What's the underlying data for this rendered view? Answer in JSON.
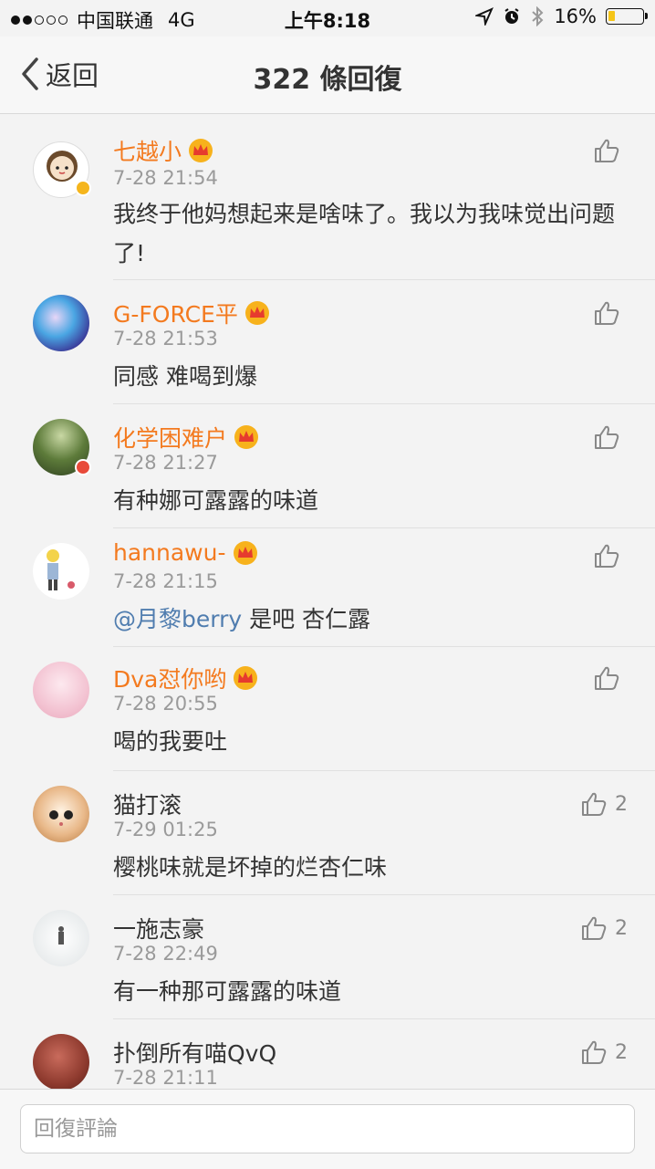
{
  "status": {
    "carrier": "中国联通",
    "network": "4G",
    "time": "上午8:18",
    "battery": "16%"
  },
  "nav": {
    "back_label": "返回",
    "title": "322 條回復"
  },
  "comments": [
    {
      "name": "七越小",
      "time": "7-28 21:54",
      "text": "我终于他妈想起来是啥味了。我以为我味觉出问题了!",
      "likes": "",
      "vip": true
    },
    {
      "name": "G-FORCE平",
      "time": "7-28 21:53",
      "text": "同感 难喝到爆",
      "likes": "",
      "vip": true
    },
    {
      "name": "化学困难户",
      "time": "7-28 21:27",
      "text": "有种娜可露露的味道",
      "likes": "",
      "vip": true
    },
    {
      "name": "hannawu-",
      "time": "7-28 21:15",
      "mention": "@月黎berry",
      "text": " 是吧 杏仁露",
      "likes": "",
      "vip": true
    },
    {
      "name": "Dva怼你哟",
      "time": "7-28 20:55",
      "text": "喝的我要吐",
      "likes": "",
      "vip": true
    },
    {
      "name": "猫打滚",
      "time": "7-29 01:25",
      "text": "樱桃味就是坏掉的烂杏仁味",
      "likes": "2",
      "vip": false
    },
    {
      "name": "一施志豪",
      "time": "7-28 22:49",
      "text": "有一种那可露露的味道",
      "likes": "2",
      "vip": false
    },
    {
      "name": "扑倒所有喵QvQ",
      "time": "7-28 21:11",
      "text": "",
      "likes": "2",
      "vip": false
    }
  ],
  "input": {
    "placeholder": "回復評論"
  },
  "colors": {
    "vip_name": "#f37a1f",
    "mention": "#507daf",
    "battery_fill": "#f5c518"
  }
}
